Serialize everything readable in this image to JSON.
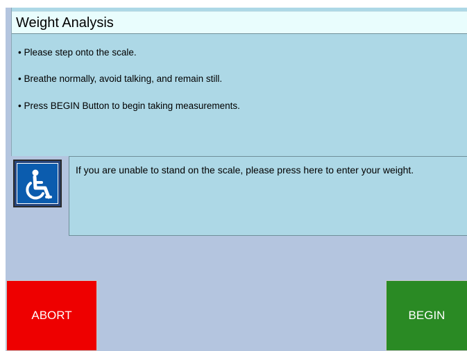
{
  "title": "Weight Analysis",
  "instructions": [
    "• Please step onto the scale.",
    "• Breathe normally, avoid talking, and remain still.",
    "• Press BEGIN Button to begin taking measurements."
  ],
  "manual_entry": {
    "icon": "wheelchair-icon",
    "text": "If you are unable to stand on the scale, please press here to enter your weight."
  },
  "buttons": {
    "abort_label": "ABORT",
    "begin_label": "BEGIN"
  },
  "colors": {
    "background": "#b4c5df",
    "panel": "#add8e6",
    "title_bar": "#e9fdfd",
    "abort": "#ee0000",
    "begin": "#2a8a24",
    "accessibility_icon": "#0b5cae"
  }
}
